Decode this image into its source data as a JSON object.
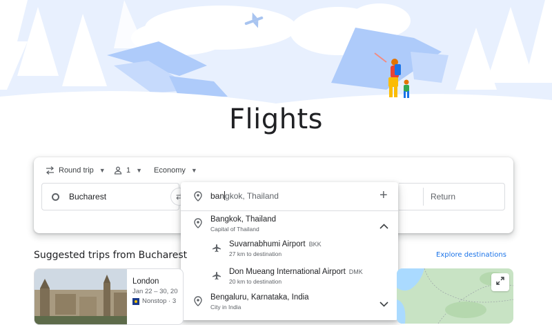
{
  "page_title": "Flights",
  "trip_options": {
    "trip_type": "Round trip",
    "passengers": "1",
    "cabin_class": "Economy"
  },
  "search": {
    "origin": "Bucharest",
    "destination_typed": "ban",
    "destination_suggestion": "gkok, Thailand",
    "return_placeholder": "Return"
  },
  "dropdown": {
    "results": [
      {
        "title": "Bangkok, Thailand",
        "subtitle": "Capital of Thailand",
        "type": "city",
        "expanded": true
      },
      {
        "title": "Suvarnabhumi Airport",
        "code": "BKK",
        "subtitle": "27 km to destination",
        "type": "airport"
      },
      {
        "title": "Don Mueang International Airport",
        "code": "DMK",
        "subtitle": "20 km to destination",
        "type": "airport"
      },
      {
        "title": "Bengaluru, Karnataka, India",
        "subtitle": "City in India",
        "type": "city",
        "expanded": false
      }
    ]
  },
  "suggested": {
    "title": "Suggested trips from Bucharest",
    "explore_link": "Explore destinations",
    "trips": [
      {
        "city": "London",
        "dates": "Jan 22 – 30, 20",
        "flight": "Nonstop · 3"
      }
    ]
  },
  "colors": {
    "accent": "#1a73e8",
    "hero_sky": "#e8f0fe",
    "mountain": "#aecbfa",
    "text": "#202124",
    "secondary_text": "#5f6368"
  }
}
